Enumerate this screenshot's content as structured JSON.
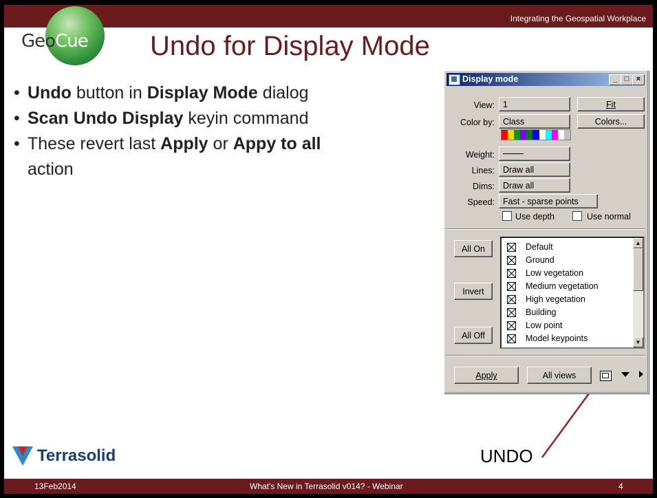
{
  "slide": {
    "header_tagline": "Integrating the Geospatial Workplace",
    "logo_text_left": "Geo",
    "logo_text_right": "Cue",
    "title": "Undo for Display Mode",
    "bullets": [
      {
        "parts": [
          {
            "t": "Undo",
            "b": true
          },
          {
            "t": " button in ",
            "b": false
          },
          {
            "t": "Display Mode",
            "b": true
          },
          {
            "t": " dialog",
            "b": false
          }
        ]
      },
      {
        "parts": [
          {
            "t": "Scan Undo Display",
            "b": true
          },
          {
            "t": " keyin command",
            "b": false
          }
        ]
      },
      {
        "parts": [
          {
            "t": "These revert last ",
            "b": false
          },
          {
            "t": "Apply",
            "b": true
          },
          {
            "t": " or ",
            "b": false
          },
          {
            "t": "Appy to all",
            "b": true
          }
        ]
      },
      {
        "parts": [
          {
            "t": "action",
            "b": false
          }
        ]
      }
    ],
    "brand": "Terrasolid",
    "undo_annotation": "UNDO",
    "footer": {
      "date": "13Feb2014",
      "center": "What's New in Terrasolid v014? - Webinar",
      "page": "4"
    }
  },
  "dialog": {
    "title": "Display mode",
    "window_buttons": [
      "_",
      "□",
      "×"
    ],
    "view_label": "View:",
    "view_value": "1",
    "fit_button": "Fit",
    "color_by_label": "Color by:",
    "color_by_value": "Class",
    "colors_button": "Colors...",
    "color_swatch": [
      "#ff0000",
      "#ffd700",
      "#00a000",
      "#8000ff",
      "#008000",
      "#0000ff",
      "#ffffff",
      "#00ffff",
      "#ff00ff",
      "#ffffff",
      "#c0c0c0"
    ],
    "weight_label": "Weight:",
    "lines_label": "Lines:",
    "lines_value": "Draw all",
    "dims_label": "Dims:",
    "dims_value": "Draw all",
    "speed_label": "Speed:",
    "speed_value": "Fast - sparse points",
    "use_depth": "Use depth",
    "use_normal": "Use normal",
    "all_on": "All On",
    "invert": "Invert",
    "all_off": "All Off",
    "classes": [
      "Default",
      "Ground",
      "Low vegetation",
      "Medium vegetation",
      "High vegetation",
      "Building",
      "Low point",
      "Model keypoints"
    ],
    "apply": "Apply",
    "all_views": "All views"
  }
}
